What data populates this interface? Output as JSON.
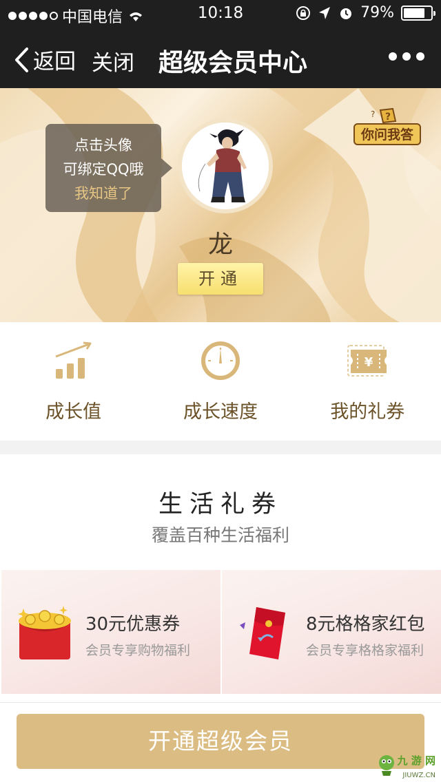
{
  "status_bar": {
    "carrier": "中国电信",
    "time": "10:18",
    "battery_percent": "79%",
    "battery_level": 0.79,
    "icons": [
      "signal-dots",
      "wifi-icon",
      "rotation-lock-icon",
      "location-arrow-icon",
      "alarm-icon",
      "battery-icon"
    ]
  },
  "nav": {
    "back_label": "返回",
    "close_label": "关闭",
    "title": "超级会员中心",
    "more_icon": "more-dots-icon"
  },
  "hero": {
    "tooltip_line1": "点击头像",
    "tooltip_line2": "可绑定QQ哦",
    "tooltip_ack": "我知道了",
    "username": "龙",
    "open_button": "开通",
    "ask_badge_label": "你问我答"
  },
  "stats": [
    {
      "label": "成长值",
      "icon": "growth-chart-icon"
    },
    {
      "label": "成长速度",
      "icon": "speedometer-icon"
    },
    {
      "label": "我的礼券",
      "icon": "ticket-icon"
    }
  ],
  "life_coupons": {
    "title": "生活礼券",
    "subtitle": "覆盖百种生活福利",
    "items": [
      {
        "name": "30元优惠券",
        "desc": "会员专享购物福利",
        "icon": "gold-red-envelope-icon"
      },
      {
        "name": "8元格格家红包",
        "desc": "会员专享格格家福利",
        "icon": "red-packet-icon"
      }
    ]
  },
  "bottom": {
    "join_button": "开通超级会员",
    "watermark_cn": "九 游 网",
    "watermark_en": "JIUWZ.CN"
  },
  "colors": {
    "nav_bg": "#1f1f1f",
    "gold_accent": "#dbbd83",
    "stat_brown": "#6b5228",
    "open_button_yellow": "#f7df6f"
  }
}
